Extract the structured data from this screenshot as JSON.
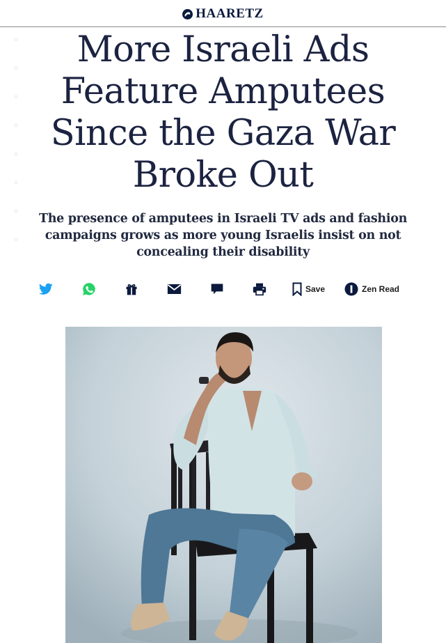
{
  "masthead": {
    "logo_text": "HAARETZ",
    "logo_icon": "haaretz-logo-icon"
  },
  "article": {
    "headline": "More Israeli Ads Feature Amputees Since the Gaza War Broke Out",
    "subheadline": "The presence of amputees in Israeli TV ads and fashion campaigns grows as more young Israelis insist on not concealing their disability"
  },
  "share_bar": {
    "items": [
      {
        "icon": "twitter-icon",
        "color": "#1da1f2"
      },
      {
        "icon": "whatsapp-icon",
        "color": "#25d366"
      },
      {
        "icon": "gift-icon",
        "color": "#0b1a3d"
      },
      {
        "icon": "mail-icon",
        "color": "#0b1a3d"
      },
      {
        "icon": "comment-icon",
        "color": "#0b1a3d"
      },
      {
        "icon": "print-icon",
        "color": "#0b1a3d"
      }
    ],
    "save_label": "Save",
    "zen_label": "Zen Read"
  },
  "hero_image": {
    "icon": "article-photo"
  },
  "colors": {
    "headline": "#1c2341",
    "twitter": "#1da1f2",
    "whatsapp": "#25d366",
    "navy": "#0b1a3d"
  }
}
